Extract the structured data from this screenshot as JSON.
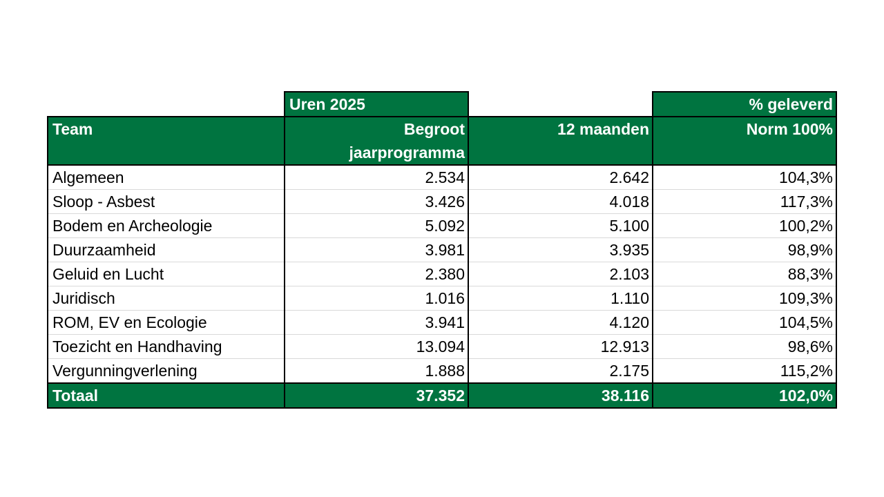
{
  "table": {
    "group_header_uren": "Uren 2025",
    "group_header_pct": "% geleverd",
    "columns": {
      "team": "Team",
      "begroot_line1": "Begroot",
      "begroot_line2": "jaarprogramma",
      "maanden": "12 maanden",
      "norm": "Norm 100%"
    },
    "rows": [
      {
        "team": "Algemeen",
        "begroot": "2.534",
        "maanden": "2.642",
        "pct": "104,3%"
      },
      {
        "team": "Sloop - Asbest",
        "begroot": "3.426",
        "maanden": "4.018",
        "pct": "117,3%"
      },
      {
        "team": "Bodem en Archeologie",
        "begroot": "5.092",
        "maanden": "5.100",
        "pct": "100,2%"
      },
      {
        "team": "Duurzaamheid",
        "begroot": "3.981",
        "maanden": "3.935",
        "pct": "98,9%"
      },
      {
        "team": "Geluid en Lucht",
        "begroot": "2.380",
        "maanden": "2.103",
        "pct": "88,3%"
      },
      {
        "team": "Juridisch",
        "begroot": "1.016",
        "maanden": "1.110",
        "pct": "109,3%"
      },
      {
        "team": "ROM, EV en Ecologie",
        "begroot": "3.941",
        "maanden": "4.120",
        "pct": "104,5%"
      },
      {
        "team": "Toezicht en Handhaving",
        "begroot": "13.094",
        "maanden": "12.913",
        "pct": "98,6%"
      },
      {
        "team": "Vergunningverlening",
        "begroot": "1.888",
        "maanden": "2.175",
        "pct": "115,2%"
      }
    ],
    "total": {
      "team": "Totaal",
      "begroot": "37.352",
      "maanden": "38.116",
      "pct": "102,0%"
    }
  },
  "colors": {
    "header_green": "#007440",
    "header_text": "#ffffff"
  }
}
